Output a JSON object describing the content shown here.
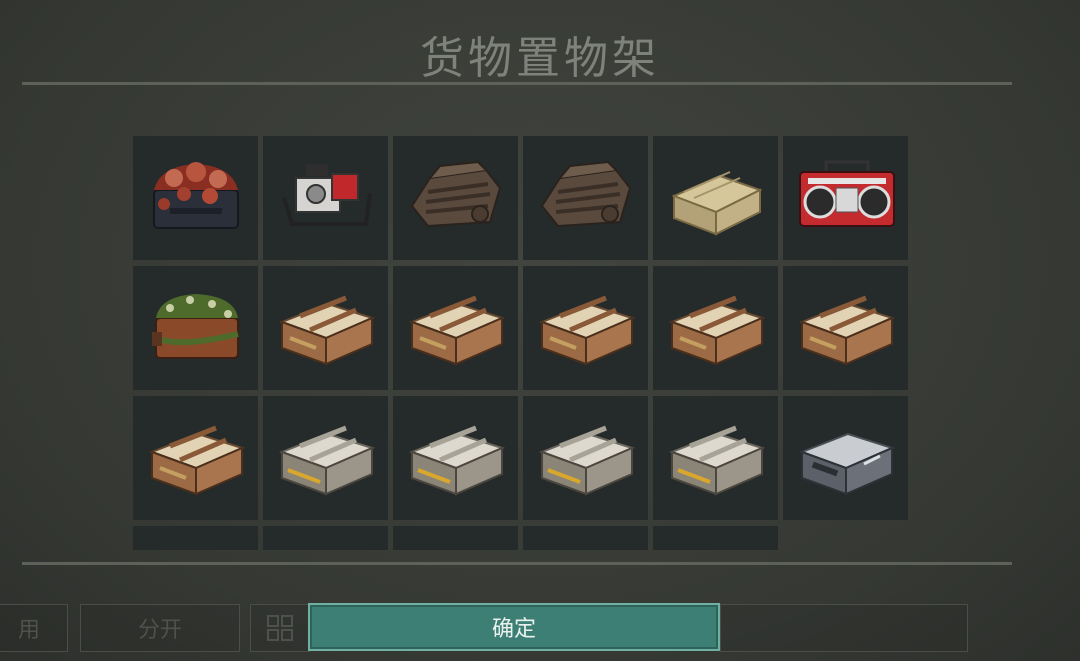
{
  "panel": {
    "title": "货物置物架"
  },
  "background_buttons": [
    {
      "label": "用"
    },
    {
      "label": "分开"
    },
    {
      "label": ""
    },
    {
      "label": ""
    }
  ],
  "confirm": {
    "label": "确定"
  },
  "accent_color": "#3d7f74",
  "items": [
    {
      "name": "flesh-crate-icon"
    },
    {
      "name": "generator-icon"
    },
    {
      "name": "engine-part-icon"
    },
    {
      "name": "engine-part-icon"
    },
    {
      "name": "wooden-crate-icon"
    },
    {
      "name": "boombox-icon"
    },
    {
      "name": "moss-chest-icon"
    },
    {
      "name": "brown-crate-icon"
    },
    {
      "name": "brown-crate-icon"
    },
    {
      "name": "brown-crate-icon"
    },
    {
      "name": "brown-crate-icon"
    },
    {
      "name": "brown-crate-icon"
    },
    {
      "name": "brown-crate-icon"
    },
    {
      "name": "grey-crate-icon"
    },
    {
      "name": "grey-crate-icon"
    },
    {
      "name": "grey-crate-icon"
    },
    {
      "name": "grey-crate-icon"
    },
    {
      "name": "metal-case-icon"
    },
    {
      "name": "partial-item-icon"
    },
    {
      "name": "partial-item-icon"
    },
    {
      "name": "partial-item-icon"
    },
    {
      "name": "partial-item-icon"
    },
    {
      "name": "partial-item-icon"
    }
  ]
}
